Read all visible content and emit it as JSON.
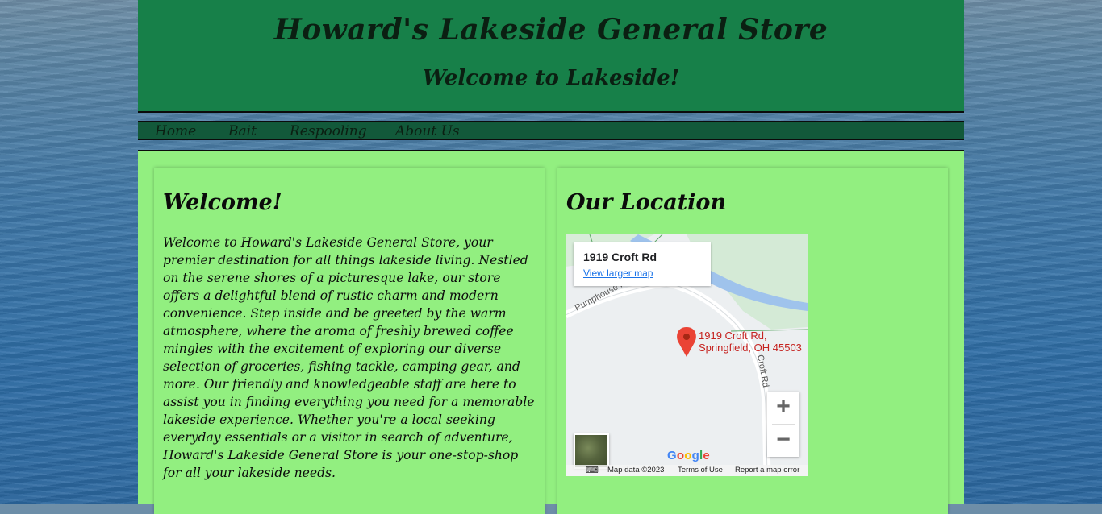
{
  "header": {
    "title": "Howard's Lakeside General Store",
    "subtitle": "Welcome to Lakeside!"
  },
  "nav": {
    "items": [
      {
        "label": "Home"
      },
      {
        "label": "Bait"
      },
      {
        "label": "Respooling"
      },
      {
        "label": "About Us"
      }
    ]
  },
  "welcome": {
    "heading": "Welcome!",
    "body": "Welcome to Howard's Lakeside General Store, your premier destination for all things lakeside living. Nestled on the serene shores of a picturesque lake, our store offers a delightful blend of rustic charm and modern convenience. Step inside and be greeted by the warm atmosphere, where the aroma of freshly brewed coffee mingles with the excitement of exploring our diverse selection of groceries, fishing tackle, camping gear, and more. Our friendly and knowledgeable staff are here to assist you in finding everything you need for a memorable lakeside experience. Whether you're a local seeking everyday essentials or a visitor in search of adventure, Howard's Lakeside General Store is your one-stop-shop for all your lakeside needs."
  },
  "location": {
    "heading": "Our Location",
    "map": {
      "card_address": "1919 Croft Rd",
      "view_larger": "View larger map",
      "pin_label_line1": "1919 Croft Rd,",
      "pin_label_line2": "Springfield, OH 45503",
      "road_label_1": "Croft Rd",
      "road_label_2": "Pumphouse Rd",
      "zoom_in": "+",
      "zoom_out": "−",
      "logo": "Google",
      "attribution": {
        "map_data": "Map data ©2023",
        "terms": "Terms of Use",
        "report": "Report a map error"
      }
    }
  },
  "colors": {
    "header_bg": "#178049",
    "nav_bg": "#12593a",
    "content_bg": "#92ef80",
    "pin": "#ea4335"
  }
}
